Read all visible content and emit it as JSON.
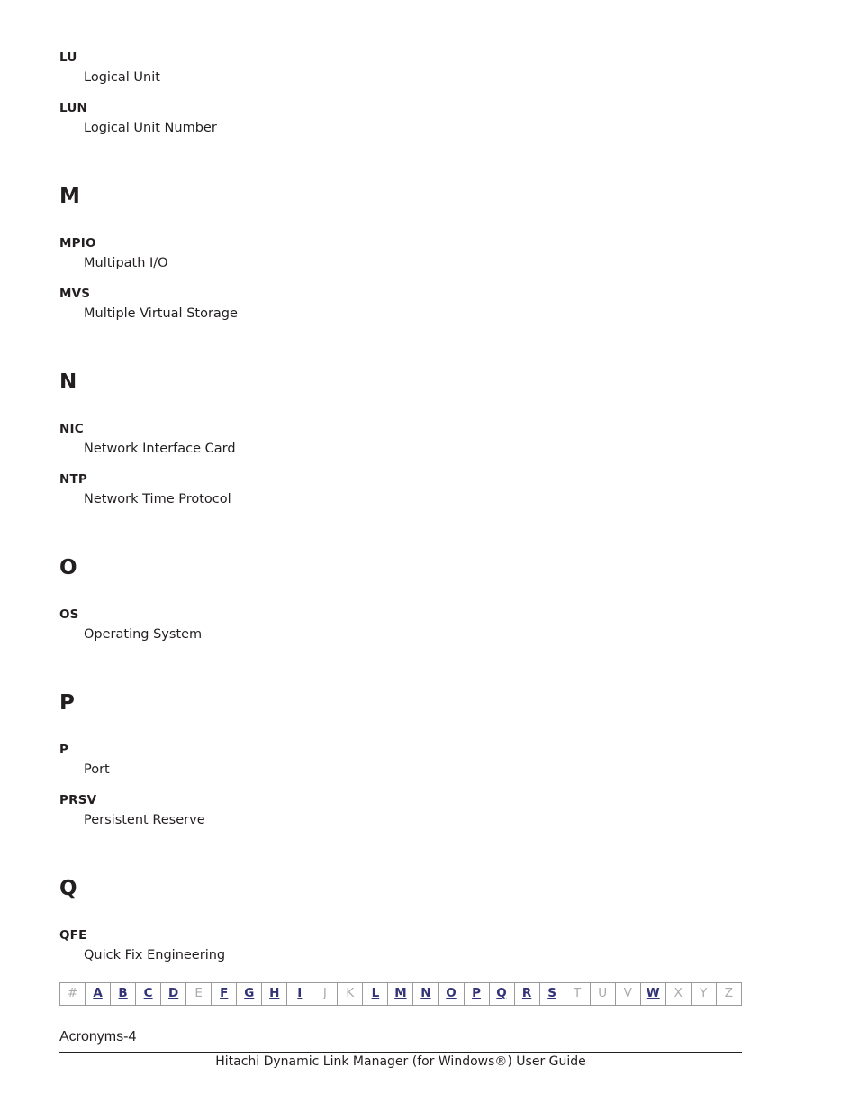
{
  "document": {
    "page_label": "Acronyms-4",
    "footer_title": "Hitachi Dynamic Link Manager (for Windows®) User Guide"
  },
  "glossary": {
    "leading_entries": [
      {
        "term": "LU",
        "definition": "Logical Unit"
      },
      {
        "term": "LUN",
        "definition": "Logical Unit Number"
      }
    ],
    "sections": [
      {
        "letter": "M",
        "entries": [
          {
            "term": "MPIO",
            "definition": "Multipath I/O"
          },
          {
            "term": "MVS",
            "definition": "Multiple Virtual Storage"
          }
        ]
      },
      {
        "letter": "N",
        "entries": [
          {
            "term": "NIC",
            "definition": "Network Interface Card"
          },
          {
            "term": "NTP",
            "definition": "Network Time Protocol"
          }
        ]
      },
      {
        "letter": "O",
        "entries": [
          {
            "term": "OS",
            "definition": "Operating System"
          }
        ]
      },
      {
        "letter": "P",
        "entries": [
          {
            "term": "P",
            "definition": "Port"
          },
          {
            "term": "PRSV",
            "definition": "Persistent Reserve"
          }
        ]
      },
      {
        "letter": "Q",
        "entries": [
          {
            "term": "QFE",
            "definition": "Quick Fix Engineering"
          }
        ]
      }
    ]
  },
  "alpha_nav": {
    "active_color": "#333377",
    "inactive_color": "#aaaaaa",
    "cells": [
      {
        "label": "#",
        "active": false
      },
      {
        "label": "A",
        "active": true
      },
      {
        "label": "B",
        "active": true
      },
      {
        "label": "C",
        "active": true
      },
      {
        "label": "D",
        "active": true
      },
      {
        "label": "E",
        "active": false
      },
      {
        "label": "F",
        "active": true
      },
      {
        "label": "G",
        "active": true
      },
      {
        "label": "H",
        "active": true
      },
      {
        "label": "I",
        "active": true
      },
      {
        "label": "J",
        "active": false
      },
      {
        "label": "K",
        "active": false
      },
      {
        "label": "L",
        "active": true
      },
      {
        "label": "M",
        "active": true
      },
      {
        "label": "N",
        "active": true
      },
      {
        "label": "O",
        "active": true
      },
      {
        "label": "P",
        "active": true
      },
      {
        "label": "Q",
        "active": true
      },
      {
        "label": "R",
        "active": true
      },
      {
        "label": "S",
        "active": true
      },
      {
        "label": "T",
        "active": false
      },
      {
        "label": "U",
        "active": false
      },
      {
        "label": "V",
        "active": false
      },
      {
        "label": "W",
        "active": true
      },
      {
        "label": "X",
        "active": false
      },
      {
        "label": "Y",
        "active": false
      },
      {
        "label": "Z",
        "active": false
      }
    ]
  }
}
